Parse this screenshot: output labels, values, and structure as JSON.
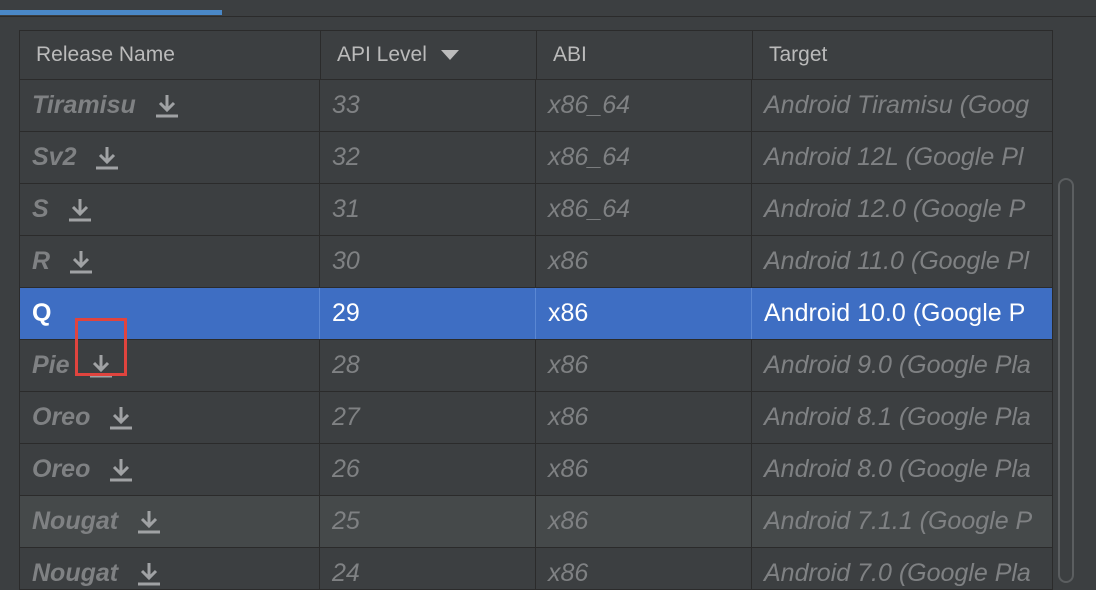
{
  "columns": {
    "release_name": "Release Name",
    "api_level": "API Level",
    "abi": "ABI",
    "target": "Target"
  },
  "sort": {
    "column": "api_level",
    "direction": "descending",
    "icon": "sort-desc-icon"
  },
  "rows": [
    {
      "name": "Tiramisu",
      "api": "33",
      "abi": "x86_64",
      "target": "Android Tiramisu (Goog",
      "download": true,
      "selected": false
    },
    {
      "name": "Sv2",
      "api": "32",
      "abi": "x86_64",
      "target": "Android 12L (Google Pl",
      "download": true,
      "selected": false
    },
    {
      "name": "S",
      "api": "31",
      "abi": "x86_64",
      "target": "Android 12.0 (Google P",
      "download": true,
      "selected": false
    },
    {
      "name": "R",
      "api": "30",
      "abi": "x86",
      "target": "Android 11.0 (Google Pl",
      "download": true,
      "selected": false
    },
    {
      "name": "Q",
      "api": "29",
      "abi": "x86",
      "target": "Android 10.0 (Google P",
      "download": false,
      "selected": true
    },
    {
      "name": "Pie",
      "api": "28",
      "abi": "x86",
      "target": "Android 9.0 (Google Pla",
      "download": true,
      "selected": false
    },
    {
      "name": "Oreo",
      "api": "27",
      "abi": "x86",
      "target": "Android 8.1 (Google Pla",
      "download": true,
      "selected": false
    },
    {
      "name": "Oreo",
      "api": "26",
      "abi": "x86",
      "target": "Android 8.0 (Google Pla",
      "download": true,
      "selected": false
    },
    {
      "name": "Nougat",
      "api": "25",
      "abi": "x86",
      "target": "Android 7.1.1 (Google P",
      "download": true,
      "selected": false
    },
    {
      "name": "Nougat",
      "api": "24",
      "abi": "x86",
      "target": "Android 7.0 (Google Pla",
      "download": true,
      "selected": false
    }
  ],
  "highlighted_element": "download-icon on row Pie",
  "colors": {
    "selection": "#3e6ec3",
    "highlight_border": "#e0443e",
    "tab_indicator": "#4a88c7",
    "background": "#3c3f41"
  }
}
